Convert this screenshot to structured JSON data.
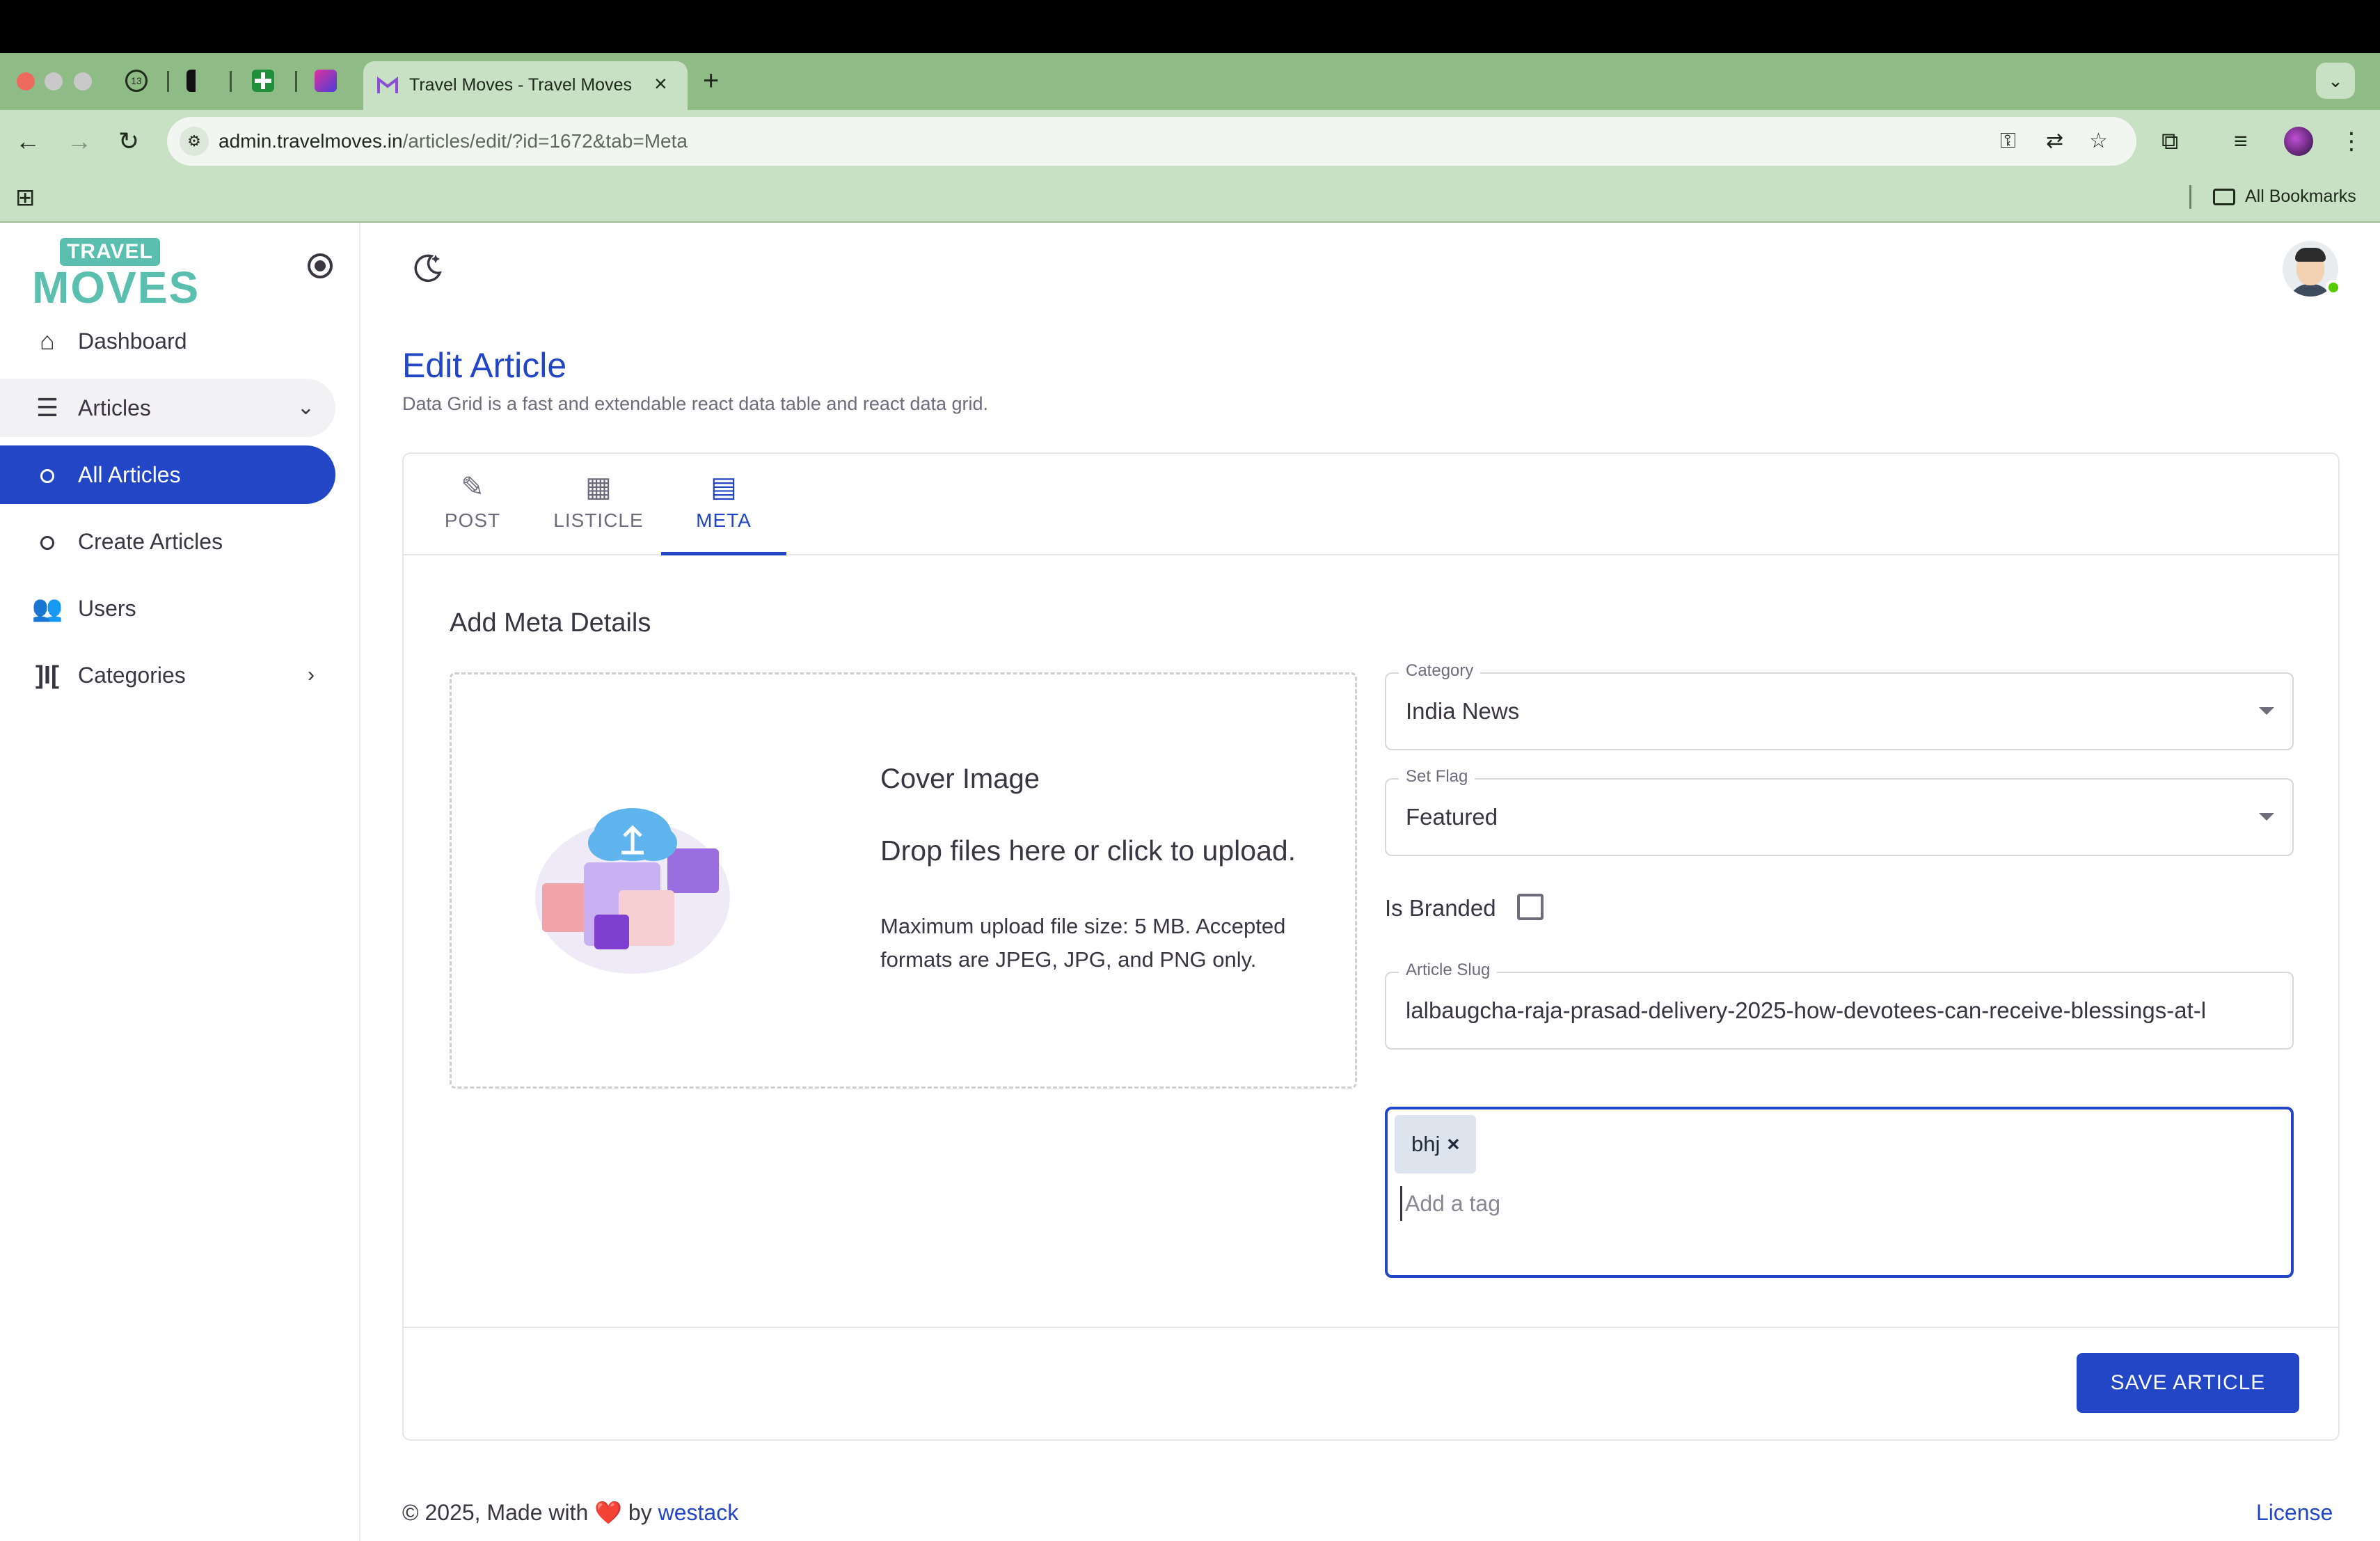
{
  "browser": {
    "active_tab_title": "Travel Moves - Travel Moves",
    "close_glyph": "×",
    "new_tab_glyph": "+",
    "tab_dropdown_glyph": "⌄",
    "mini_tab_badge": "13",
    "url_host": "admin.travelmoves.in",
    "url_path": "/articles/edit/?id=1672&tab=Meta",
    "bookmarks_label": "All Bookmarks"
  },
  "sidebar": {
    "logo_top": "TRAVEL",
    "logo_bottom": "MOVES",
    "items": [
      {
        "label": "Dashboard",
        "icon": "home-icon"
      },
      {
        "label": "Articles",
        "icon": "article-icon"
      },
      {
        "label": "All Articles",
        "icon": "circle-icon"
      },
      {
        "label": "Create Articles",
        "icon": "circle-icon"
      },
      {
        "label": "Users",
        "icon": "users-icon"
      },
      {
        "label": "Categories",
        "icon": "categories-icon"
      }
    ]
  },
  "header": {
    "title": "Edit Article",
    "subtitle": "Data Grid is a fast and extendable react data table and react data grid."
  },
  "tabs": [
    {
      "label": "POST",
      "icon": "post-add-icon"
    },
    {
      "label": "LISTICLE",
      "icon": "gallery-icon"
    },
    {
      "label": "META",
      "icon": "meta-icon"
    }
  ],
  "meta": {
    "section_title": "Add Meta Details",
    "cover_title": "Cover Image",
    "cover_drop": "Drop files here or click to upload.",
    "cover_note": "Maximum upload file size: 5 MB. Accepted formats are JPEG, JPG, and PNG only.",
    "category_label": "Category",
    "category_value": "India News",
    "flag_label": "Set Flag",
    "flag_value": "Featured",
    "branded_label": "Is Branded",
    "branded_checked": false,
    "slug_label": "Article Slug",
    "slug_value": "lalbaugcha-raja-prasad-delivery-2025-how-devotees-can-receive-blessings-at-l",
    "tags": [
      "bhj"
    ],
    "tag_remove_glyph": "×",
    "tag_placeholder": "Add a tag",
    "save_label": "SAVE ARTICLE"
  },
  "footer": {
    "copyright": "© 2025, Made with",
    "heart": "❤️",
    "by": "by",
    "author": "westack",
    "license": "License"
  },
  "colors": {
    "primary": "#2346c6",
    "brand_teal": "#5bbfb0",
    "browser_frame": "#8fbb86",
    "online": "#56ca00"
  }
}
